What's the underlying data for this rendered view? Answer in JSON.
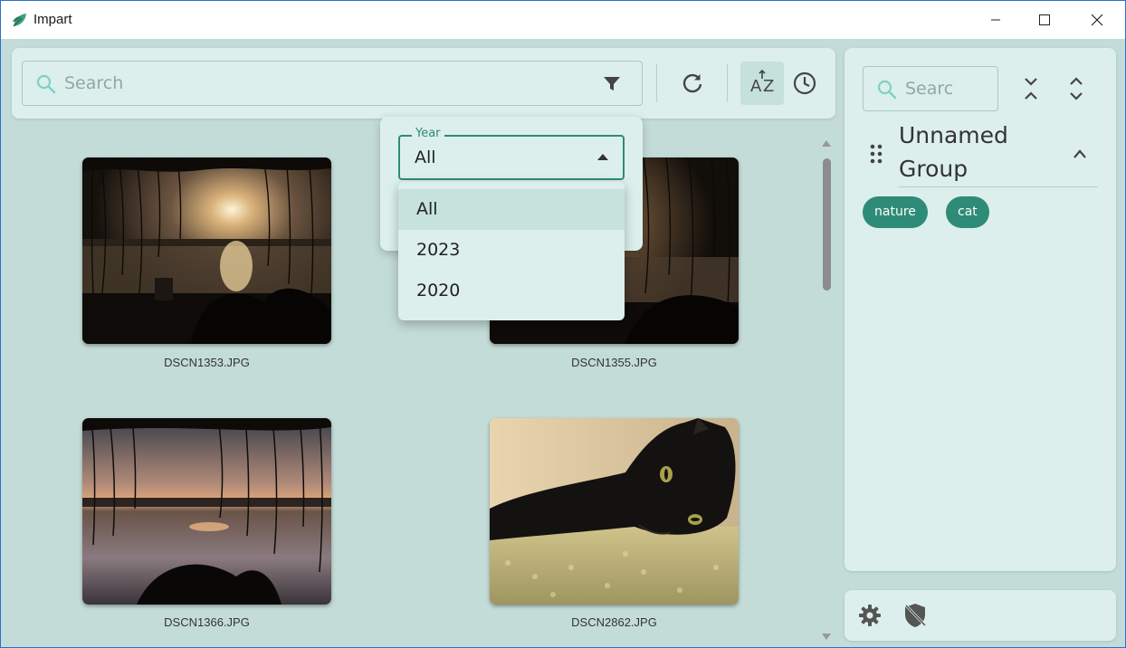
{
  "window": {
    "title": "Impart",
    "controls": [
      "minimize-icon",
      "maximize-icon",
      "close-icon"
    ]
  },
  "toolbar": {
    "search_placeholder": "Search",
    "icons": [
      "search-icon",
      "filter-icon",
      "refresh-icon",
      "sort-alpha-icon",
      "history-icon"
    ],
    "sort_alpha_active": true
  },
  "filter_popup": {
    "year_label": "Year",
    "year_value": "All",
    "options": [
      "All",
      "2023",
      "2020"
    ],
    "selected": "All"
  },
  "images": [
    {
      "name": "DSCN1353.JPG"
    },
    {
      "name": "DSCN1355.JPG"
    },
    {
      "name": "DSCN1366.JPG"
    },
    {
      "name": "DSCN2862.JPG"
    }
  ],
  "sidebar": {
    "search_placeholder": "Searc",
    "group_title": "Unnamed Group",
    "tags": [
      "nature",
      "cat"
    ]
  },
  "colors": {
    "accent": "#2e8b78",
    "panel": "#dcefec",
    "background": "#c4dcd8"
  }
}
